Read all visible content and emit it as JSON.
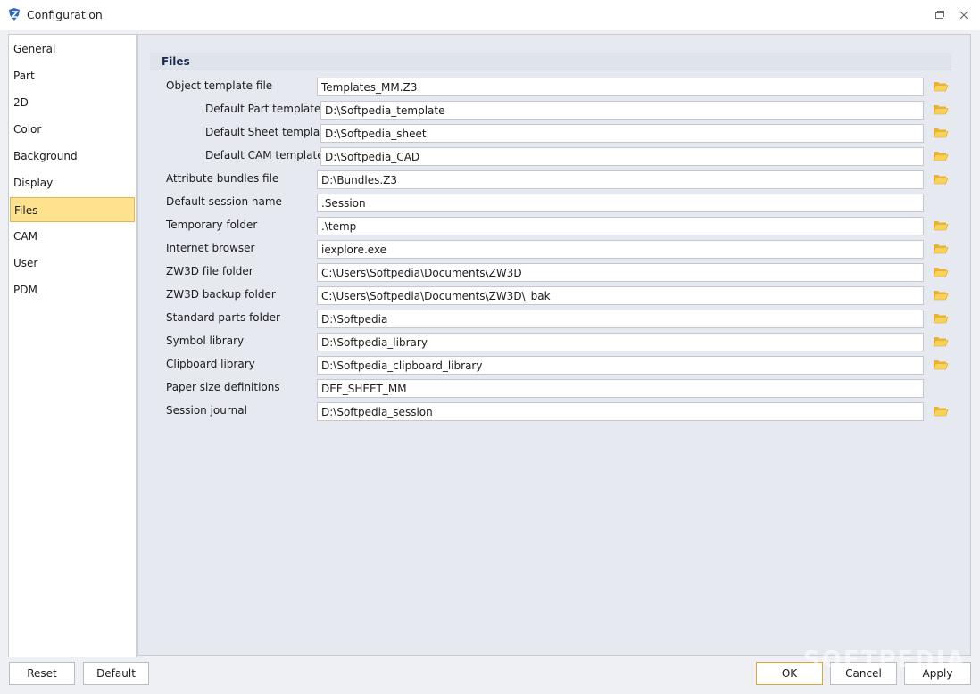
{
  "window": {
    "title": "Configuration",
    "icon": "zw3d-app-icon",
    "controls": [
      "restore-icon",
      "close-icon"
    ]
  },
  "sidebar": {
    "items": [
      {
        "label": "General"
      },
      {
        "label": "Part"
      },
      {
        "label": "2D"
      },
      {
        "label": "Color"
      },
      {
        "label": "Background"
      },
      {
        "label": "Display"
      },
      {
        "label": "Files",
        "selected": true
      },
      {
        "label": "CAM"
      },
      {
        "label": "User"
      },
      {
        "label": "PDM"
      }
    ],
    "selected_color": "#ffe18e"
  },
  "main": {
    "section_title": "Files",
    "rows": [
      {
        "label": "Object template file",
        "value": "Templates_MM.Z3",
        "folder_icon": true
      },
      {
        "label": "Default Part template",
        "value": "D:\\Softpedia_template",
        "folder_icon": true,
        "indent": true
      },
      {
        "label": "Default Sheet template",
        "value": "D:\\Softpedia_sheet",
        "folder_icon": true,
        "indent": true
      },
      {
        "label": "Default CAM template",
        "value": "D:\\Softpedia_CAD",
        "folder_icon": true,
        "indent": true
      },
      {
        "label": "Attribute bundles file",
        "value": "D:\\Bundles.Z3",
        "folder_icon": true
      },
      {
        "label": "Default session name",
        "value": ".Session",
        "folder_icon": false
      },
      {
        "label": "Temporary folder",
        "value": ".\\temp",
        "folder_icon": true
      },
      {
        "label": "Internet browser",
        "value": "iexplore.exe",
        "folder_icon": true
      },
      {
        "label": "ZW3D file folder",
        "value": "C:\\Users\\Softpedia\\Documents\\ZW3D",
        "folder_icon": true
      },
      {
        "label": "ZW3D backup folder",
        "value": "C:\\Users\\Softpedia\\Documents\\ZW3D\\_bak",
        "folder_icon": true
      },
      {
        "label": "Standard parts folder",
        "value": "D:\\Softpedia",
        "folder_icon": true
      },
      {
        "label": "Symbol library",
        "value": "D:\\Softpedia_library",
        "folder_icon": true
      },
      {
        "label": "Clipboard library",
        "value": "D:\\Softpedia_clipboard_library",
        "folder_icon": true
      },
      {
        "label": "Paper size definitions",
        "value": "DEF_SHEET_MM",
        "folder_icon": false
      },
      {
        "label": "Session journal",
        "value": "D:\\Softpedia_session",
        "folder_icon": true
      }
    ],
    "folder_icon_name": "folder-open-icon",
    "folder_color": "#f5c242"
  },
  "buttons": {
    "reset": "Reset",
    "default": "Default",
    "ok": "OK",
    "cancel": "Cancel",
    "apply": "Apply"
  },
  "watermark": "SOFTPEDIA"
}
